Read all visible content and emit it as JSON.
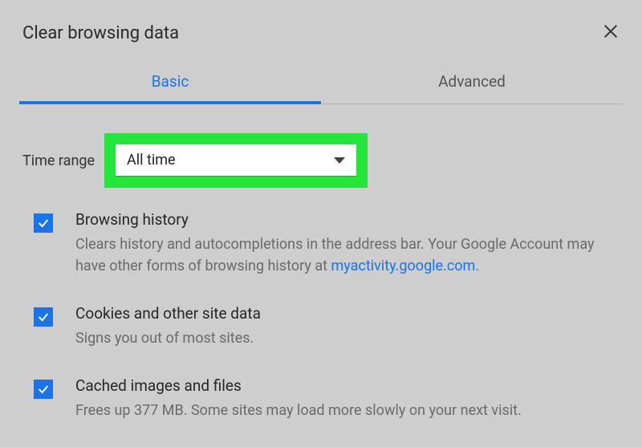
{
  "header": {
    "title": "Clear browsing data"
  },
  "tabs": {
    "basic": "Basic",
    "advanced": "Advanced"
  },
  "timerange": {
    "label": "Time range",
    "value": "All time"
  },
  "options": [
    {
      "title": "Browsing history",
      "desc_prefix": "Clears history and autocompletions in the address bar. Your Google Account may have other forms of browsing history at ",
      "link_text": "myactivity.google.com",
      "desc_suffix": "."
    },
    {
      "title": "Cookies and other site data",
      "desc_prefix": "Signs you out of most sites.",
      "link_text": "",
      "desc_suffix": ""
    },
    {
      "title": "Cached images and files",
      "desc_prefix": "Frees up 377 MB. Some sites may load more slowly on your next visit.",
      "link_text": "",
      "desc_suffix": ""
    }
  ]
}
